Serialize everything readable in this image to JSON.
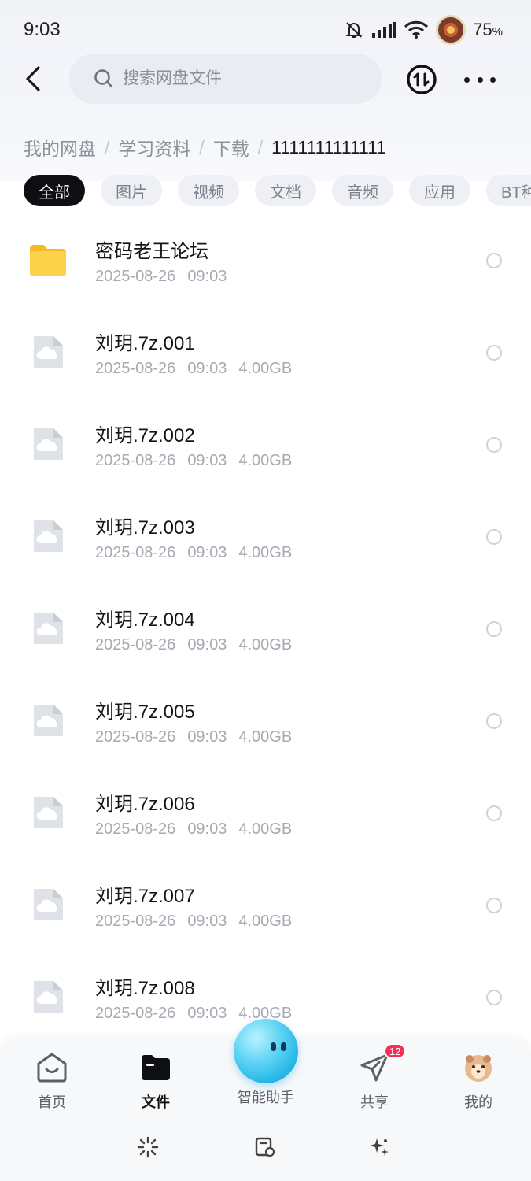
{
  "status_bar": {
    "time": "9:03",
    "battery_percent": "75",
    "battery_unit": "%",
    "icons": [
      "bell-muted-icon",
      "signal-icon",
      "wifi-icon",
      "app-notification-avatar"
    ]
  },
  "header": {
    "search_placeholder": "搜索网盘文件",
    "icons": [
      "back-arrow-icon",
      "search-icon",
      "transfer-icon",
      "more-icon"
    ]
  },
  "breadcrumb": {
    "items": [
      "我的网盘",
      "学习资料",
      "下载",
      "1111111111111"
    ],
    "separator": "/"
  },
  "filters": {
    "chips": [
      "全部",
      "图片",
      "视频",
      "文档",
      "音频",
      "应用",
      "BT种子"
    ],
    "selected": "全部"
  },
  "files": [
    {
      "name": "密码老王论坛",
      "date": "2025-08-26",
      "time": "09:03",
      "size": "",
      "type": "folder"
    },
    {
      "name": "刘玥.7z.001",
      "date": "2025-08-26",
      "time": "09:03",
      "size": "4.00GB",
      "type": "file"
    },
    {
      "name": "刘玥.7z.002",
      "date": "2025-08-26",
      "time": "09:03",
      "size": "4.00GB",
      "type": "file"
    },
    {
      "name": "刘玥.7z.003",
      "date": "2025-08-26",
      "time": "09:03",
      "size": "4.00GB",
      "type": "file"
    },
    {
      "name": "刘玥.7z.004",
      "date": "2025-08-26",
      "time": "09:03",
      "size": "4.00GB",
      "type": "file"
    },
    {
      "name": "刘玥.7z.005",
      "date": "2025-08-26",
      "time": "09:03",
      "size": "4.00GB",
      "type": "file"
    },
    {
      "name": "刘玥.7z.006",
      "date": "2025-08-26",
      "time": "09:03",
      "size": "4.00GB",
      "type": "file"
    },
    {
      "name": "刘玥.7z.007",
      "date": "2025-08-26",
      "time": "09:03",
      "size": "4.00GB",
      "type": "file"
    },
    {
      "name": "刘玥.7z.008",
      "date": "2025-08-26",
      "time": "09:03",
      "size": "4.00GB",
      "type": "file"
    }
  ],
  "bottom_nav": {
    "items": [
      {
        "label": "首页",
        "icon": "home-icon"
      },
      {
        "label": "文件",
        "icon": "folder-icon",
        "active": true
      },
      {
        "label": "智能助手",
        "icon": "ai-assistant-orb"
      },
      {
        "label": "共享",
        "icon": "share-plane-icon",
        "badge": "12"
      },
      {
        "label": "我的",
        "icon": "profile-avatar"
      }
    ],
    "tools": [
      "sparkle-burst-icon",
      "cleanup-icon",
      "magic-stars-icon"
    ]
  },
  "colors": {
    "accent_dark": "#0d0f14",
    "badge_red": "#f0325a",
    "folder_yellow": "#f7c531",
    "orb_blue": "#23b4e6"
  }
}
